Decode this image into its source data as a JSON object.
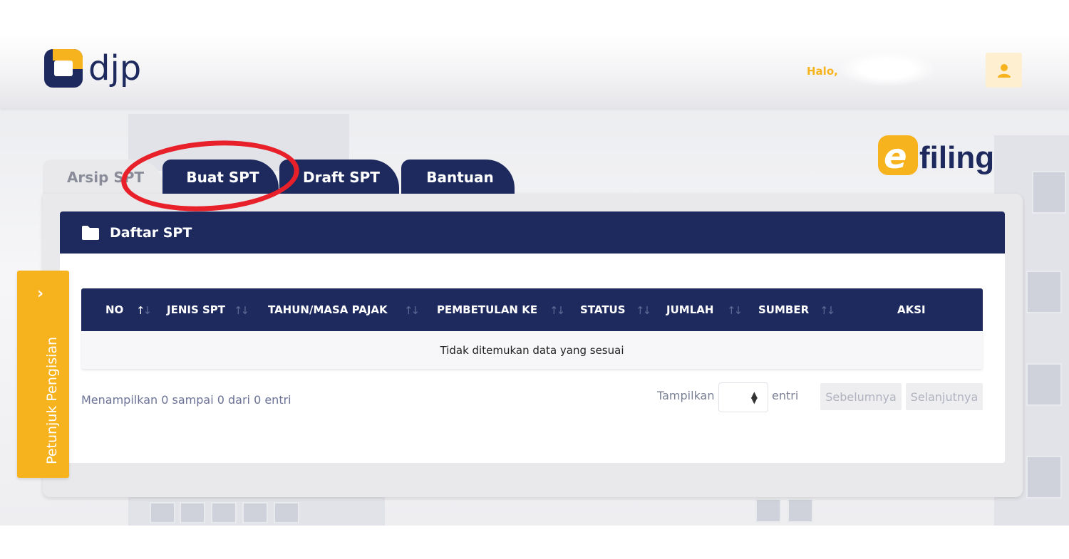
{
  "header": {
    "logo_text": "djp",
    "greeting": "Halo,"
  },
  "brand": {
    "efiling_e": "e",
    "efiling_word": "filing"
  },
  "tabs": [
    {
      "label": "Arsip SPT",
      "active": false
    },
    {
      "label": "Buat SPT",
      "active": true
    },
    {
      "label": "Draft SPT",
      "active": true
    },
    {
      "label": "Bantuan",
      "active": true
    }
  ],
  "panel": {
    "title": "Daftar SPT",
    "columns": [
      "NO",
      "JENIS SPT",
      "TAHUN/MASA PAJAK",
      "PEMBETULAN KE",
      "STATUS",
      "JUMLAH",
      "SUMBER",
      "AKSI"
    ],
    "empty_message": "Tidak ditemukan data yang sesuai",
    "info": "Menampilkan 0 sampai 0 dari 0 entri",
    "length_label": "Tampilkan",
    "length_suffix": "entri",
    "prev_label": "Sebelumnya",
    "next_label": "Selanjutnya"
  },
  "side_guide": {
    "label": "Petunjuk Pengisian",
    "chevron": "›"
  },
  "colors": {
    "navy": "#1e2a5e",
    "accent": "#f7b31e",
    "highlight": "#e8202a"
  },
  "icons": {
    "user": "user-icon",
    "folder": "folder-icon",
    "sort": "sort-icon",
    "chevron": "chevron-right-icon"
  }
}
